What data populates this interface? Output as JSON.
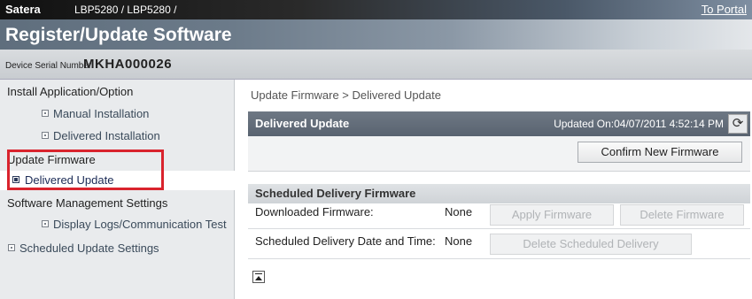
{
  "header": {
    "brand": "Satera",
    "model": "LBP5280 / LBP5280 /",
    "portal_link": "To Portal",
    "title": "Register/Update Software"
  },
  "serial": {
    "label": "Device Serial Number:",
    "value": "MKHA000026"
  },
  "sidebar": {
    "sections": [
      {
        "label": "Install Application/Option"
      },
      {
        "label": "Update Firmware"
      },
      {
        "label": "Software Management Settings"
      }
    ],
    "items": [
      {
        "label": "Manual Installation"
      },
      {
        "label": "Delivered Installation"
      },
      {
        "label": "Delivered Update",
        "active": true
      },
      {
        "label": "Display Logs/Communication Test"
      },
      {
        "label": "Scheduled Update Settings"
      }
    ]
  },
  "main": {
    "breadcrumb": "Update Firmware > Delivered Update",
    "panel": {
      "title": "Delivered Update",
      "updated": "Updated On:04/07/2011 4:52:14 PM",
      "confirm_button": "Confirm New Firmware"
    },
    "scheduled": {
      "title": "Scheduled Delivery Firmware",
      "rows": [
        {
          "label": "Downloaded Firmware:",
          "value": "None"
        },
        {
          "label": "Scheduled Delivery Date and Time:",
          "value": "None"
        }
      ],
      "apply_button": "Apply Firmware",
      "delete_button": "Delete Firmware",
      "delete_scheduled_button": "Delete Scheduled Delivery"
    }
  },
  "colors": {
    "highlight": "#d9232d",
    "panel_header": "#5f6974",
    "sidebar_bg": "#e9ebed"
  },
  "icons": {
    "refresh": "refresh-icon",
    "back_to_top": "back-to-top-icon"
  }
}
